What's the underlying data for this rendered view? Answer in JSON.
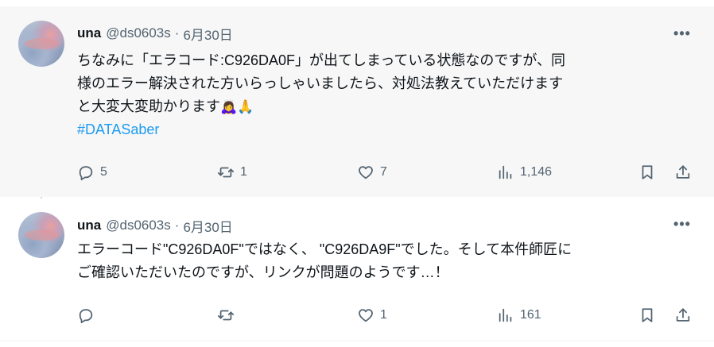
{
  "tweets": [
    {
      "name": "una",
      "handle": "@ds0603s",
      "separator": "·",
      "date": "6月30日",
      "more": "•••",
      "lines": [
        "ちなみに「エラコード:C926DA0F」が出てしまっている状態なのですが、同",
        "様のエラー解決された方いらっしゃいましたら、対処法教えていただけます",
        "と大変大変助かります"
      ],
      "emojis": "🙇‍♀️🙏",
      "hashtag": "#DATASaber",
      "replies": "5",
      "reposts": "1",
      "likes": "7",
      "views": "1,146"
    },
    {
      "name": "una",
      "handle": "@ds0603s",
      "separator": "·",
      "date": "6月30日",
      "more": "•••",
      "lines": [
        "エラーコード\"C926DA0F\"ではなく、 \"C926DA9F\"でした。そして本件師匠に",
        "ご確認いただいたのですが、リンクが問題のようです…！"
      ],
      "replies": "",
      "reposts": "",
      "likes": "1",
      "views": "161"
    }
  ],
  "icons": {
    "reply": "reply-icon",
    "repost": "repost-icon",
    "like": "heart-icon",
    "views": "views-icon",
    "bookmark": "bookmark-icon",
    "share": "share-icon"
  },
  "colors": {
    "hashtag": "#1d9bf0",
    "secondary_text": "#536471",
    "thread_line": "#cfd9de"
  }
}
